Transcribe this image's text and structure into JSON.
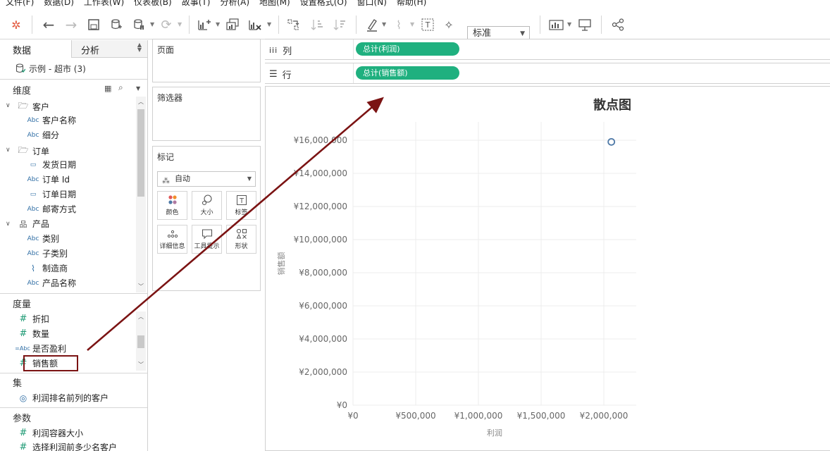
{
  "menu": [
    "文件(F)",
    "数据(D)",
    "工作表(W)",
    "仪表板(B)",
    "故事(T)",
    "分析(A)",
    "地图(M)",
    "设置格式(O)",
    "窗口(N)",
    "帮助(H)"
  ],
  "toolbar": {
    "fit_label": "标准"
  },
  "left_pane": {
    "tabs": {
      "data": "数据",
      "analysis": "分析"
    },
    "datasource": "示例 - 超市 (3)",
    "dimensions_title": "维度",
    "dimensions": [
      {
        "label": "客户",
        "icon": "folder",
        "group": true
      },
      {
        "label": "客户名称",
        "icon": "Abc"
      },
      {
        "label": "细分",
        "icon": "Abc"
      },
      {
        "label": "订单",
        "icon": "folder",
        "group": true
      },
      {
        "label": "发货日期",
        "icon": "calendar"
      },
      {
        "label": "订单 Id",
        "icon": "Abc"
      },
      {
        "label": "订单日期",
        "icon": "calendar"
      },
      {
        "label": "邮寄方式",
        "icon": "Abc"
      },
      {
        "label": "产品",
        "icon": "hierarchy",
        "group": true
      },
      {
        "label": "类别",
        "icon": "Abc"
      },
      {
        "label": "子类别",
        "icon": "Abc"
      },
      {
        "label": "制造商",
        "icon": "paperclip"
      },
      {
        "label": "产品名称",
        "icon": "Abc"
      }
    ],
    "measures_title": "度量",
    "measures": [
      {
        "label": "折扣",
        "icon": "#"
      },
      {
        "label": "数量",
        "icon": "#"
      },
      {
        "label": "是否盈利",
        "icon": "=Abc"
      },
      {
        "label": "销售额",
        "icon": "#"
      }
    ],
    "sets_title": "集",
    "sets": [
      {
        "label": "利润排名前列的客户"
      }
    ],
    "params_title": "参数",
    "params": [
      {
        "label": "利润容器大小",
        "icon": "#"
      },
      {
        "label": "选择利润前多少名客户",
        "icon": "#"
      }
    ]
  },
  "cards": {
    "pages": "页面",
    "filters": "筛选器",
    "marks": "标记",
    "marks_type": "自动",
    "mark_buttons": [
      "颜色",
      "大小",
      "标签",
      "详细信息",
      "工具提示",
      "形状"
    ]
  },
  "shelves": {
    "columns_label": "列",
    "columns_pill": "总计(利润)",
    "rows_label": "行",
    "rows_pill": "总计(销售额)"
  },
  "chart_data": {
    "type": "scatter",
    "title": "散点图",
    "xlabel": "利润",
    "ylabel": "销售额",
    "x_ticks": [
      "¥0",
      "¥500,000",
      "¥1,000,000",
      "¥1,500,000",
      "¥2,000,000"
    ],
    "y_ticks": [
      "¥0",
      "¥2,000,000",
      "¥4,000,000",
      "¥6,000,000",
      "¥8,000,000",
      "¥10,000,000",
      "¥12,000,000",
      "¥14,000,000",
      "¥16,000,000"
    ],
    "xlim": [
      0,
      2200000
    ],
    "ylim": [
      0,
      16500000
    ],
    "points": [
      {
        "x": 2060000,
        "y": 15900000
      }
    ],
    "point_color": "#4e79a7",
    "grid": true
  },
  "annotation": {
    "arrow_color": "#7b1313"
  }
}
